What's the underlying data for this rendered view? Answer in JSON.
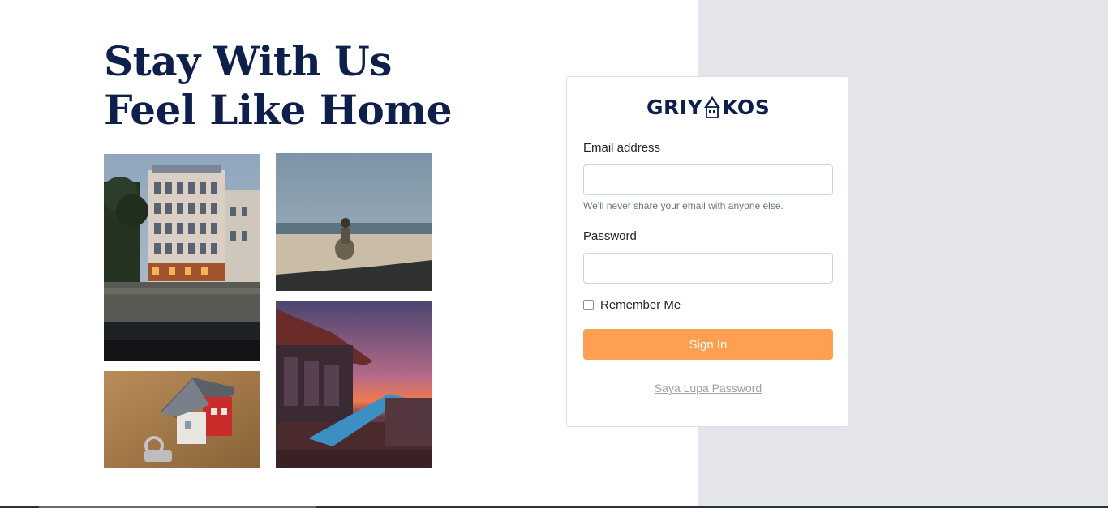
{
  "hero": {
    "line1": "Stay With Us",
    "line2": "Feel Like Home"
  },
  "gallery": {
    "photos": [
      {
        "name": "hotel-building-photo",
        "desc": "hotel-building"
      },
      {
        "name": "beach-photo",
        "desc": "beach"
      },
      {
        "name": "house-keys-photo",
        "desc": "house-keys"
      },
      {
        "name": "pool-sunset-photo",
        "desc": "pool-sunset"
      }
    ]
  },
  "login": {
    "logo_left": "GRIY",
    "logo_right": "KOS",
    "email_label": "Email address",
    "email_value": "",
    "email_placeholder": "",
    "email_help": "We'll never share your email with anyone else.",
    "password_label": "Password",
    "password_value": "",
    "password_placeholder": "",
    "remember_label": "Remember Me",
    "remember_checked": false,
    "signin_label": "Sign In",
    "forgot_label": "Saya Lupa Password"
  },
  "colors": {
    "brand_navy": "#0d1f4a",
    "accent_orange": "#ff9f51",
    "panel_grey": "#e4e5ea"
  }
}
